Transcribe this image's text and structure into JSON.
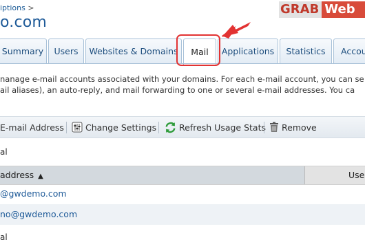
{
  "breadcrumb": {
    "text": "iptions",
    "separator": ">"
  },
  "page_title": "o.com",
  "logo": {
    "part1": "GRAB",
    "part2": "Web"
  },
  "tabs": [
    {
      "label": "Summary",
      "active": false
    },
    {
      "label": "Users",
      "active": false
    },
    {
      "label": "Websites & Domains",
      "active": false
    },
    {
      "label": "Mail",
      "active": true
    },
    {
      "label": "Applications",
      "active": false
    },
    {
      "label": "Statistics",
      "active": false
    },
    {
      "label": "Accou",
      "active": false
    }
  ],
  "description": {
    "line1": "nanage e-mail accounts associated with your domains. For each e-mail account, you can se",
    "line2": "ail aliases), an auto-reply, and mail forwarding to one or several e-mail addresses. You ca"
  },
  "toolbar": {
    "create_label": "E-mail Address",
    "change_label": "Change Settings",
    "refresh_label": "Refresh Usage Stats",
    "remove_label": "Remove"
  },
  "total_top": "al",
  "table": {
    "col_address": "address",
    "col_user": "User",
    "sort_indicator": "▲",
    "rows": [
      "@gwdemo.com",
      "no@gwdemo.com"
    ]
  },
  "total_bottom": "al",
  "colors": {
    "accent": "#1e5a98",
    "callout": "#e23232",
    "logo": "#d84b3a"
  },
  "icons": [
    "settings-icon",
    "refresh-icon",
    "trash-icon",
    "sort-asc-icon",
    "arrow-icon"
  ]
}
